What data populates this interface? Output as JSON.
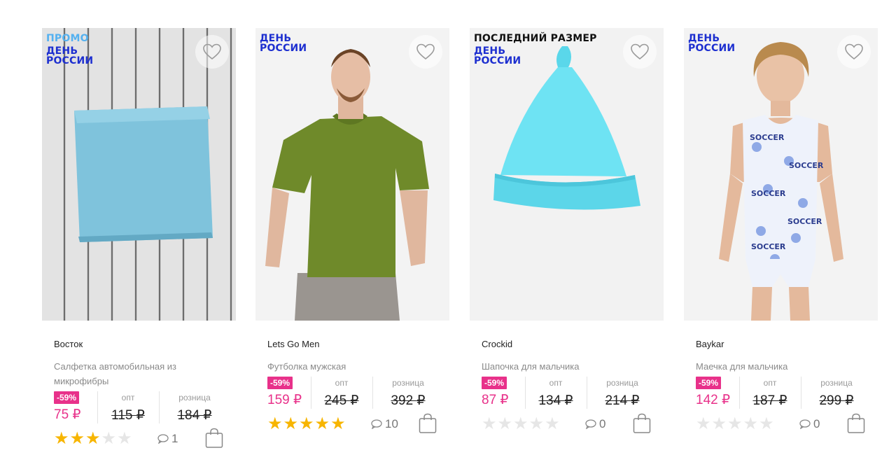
{
  "labels": {
    "opt": "опт",
    "retail": "розница"
  },
  "colors": {
    "accent": "#e8318a",
    "badge_blue": "#1d2fd0",
    "badge_promo": "#54b1f0",
    "star": "#f7b500"
  },
  "products": [
    {
      "badges": [
        "ПРОМО",
        "ДЕНЬ РОССИИ"
      ],
      "brand": "Восток",
      "title": "Салфетка автомобильная из микрофибры",
      "discount": "-59%",
      "price": "75 ₽",
      "opt_price": "115 ₽",
      "retail_price": "184 ₽",
      "rating": 3,
      "comments": "1",
      "image": "blue-towel"
    },
    {
      "badges": [
        "ДЕНЬ РОССИИ"
      ],
      "brand": "Lets Go Men",
      "title": "Футболка мужская",
      "discount": "-59%",
      "price": "159 ₽",
      "opt_price": "245 ₽",
      "retail_price": "392 ₽",
      "rating": 5,
      "comments": "10",
      "image": "green-tshirt-man"
    },
    {
      "badges": [
        "ПОСЛЕДНИЙ РАЗМЕР",
        "ДЕНЬ РОССИИ"
      ],
      "brand": "Crockid",
      "title": "Шапочка для мальчика",
      "discount": "-59%",
      "price": "87 ₽",
      "opt_price": "134 ₽",
      "retail_price": "214 ₽",
      "rating": 0,
      "comments": "0",
      "image": "turquoise-hat"
    },
    {
      "badges": [
        "ДЕНЬ РОССИИ"
      ],
      "brand": "Baykar",
      "title": "Маечка для мальчика",
      "discount": "-59%",
      "price": "142 ₽",
      "opt_price": "187 ₽",
      "retail_price": "299 ₽",
      "rating": 0,
      "comments": "0",
      "image": "boy-underwear"
    }
  ]
}
